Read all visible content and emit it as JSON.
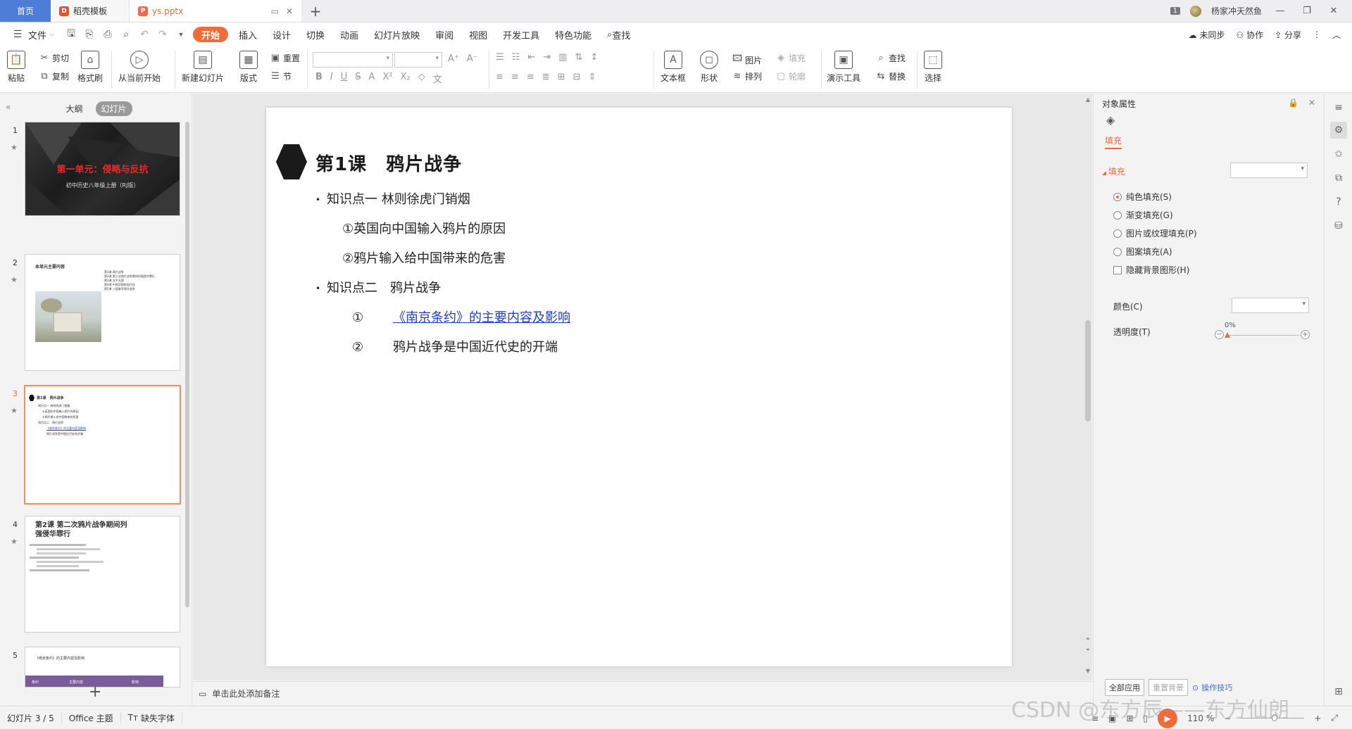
{
  "titlebar": {
    "tabs": [
      {
        "label": "首页"
      },
      {
        "label": "稻壳模板"
      },
      {
        "label": "ys.pptx"
      }
    ],
    "notif_count": "1",
    "user_name": "杨家冲天然鱼"
  },
  "menu": {
    "file": "文件",
    "items": [
      "开始",
      "插入",
      "设计",
      "切换",
      "动画",
      "幻灯片放映",
      "审阅",
      "视图",
      "开发工具",
      "特色功能"
    ],
    "search": "查找",
    "right": [
      "未同步",
      "协作",
      "分享"
    ]
  },
  "ribbon": {
    "paste": "粘贴",
    "cut": "剪切",
    "copy": "复制",
    "format_painter": "格式刷",
    "from_current": "从当前开始",
    "new_slide": "新建幻灯片",
    "layout": "版式",
    "reset": "重置",
    "section": "节",
    "textbox": "文本框",
    "shape": "形状",
    "picture": "图片",
    "fill": "填充",
    "arrange": "排列",
    "outline": "轮廓",
    "presenter_tools": "演示工具",
    "find": "查找",
    "replace": "替换",
    "select": "选择"
  },
  "left_panel": {
    "tabs": [
      "大纲",
      "幻灯片"
    ],
    "slides": [
      {
        "num": "1",
        "title": "第一单元：侵略与反抗",
        "subtitle": "初中历史八年级上册（RJ版）"
      },
      {
        "num": "2",
        "title": "本单元主要内容",
        "lines": [
          "第1课 鸦片战争",
          "第2课 第二次鸦片战争期间列强侵华罪行",
          "第3课 太平天国",
          "第4课 中国早期的现代化",
          "第5课 八国联军侵华战争"
        ]
      },
      {
        "num": "3"
      },
      {
        "num": "4",
        "title": "第2课 第二次鸦片战争期间列强侵华罪行"
      },
      {
        "num": "5",
        "title": "《南京条约》的主要内容及影响",
        "headers": [
          "条约",
          "主要内容",
          "影响"
        ]
      }
    ]
  },
  "slide": {
    "title": "第1课　鸦片战争",
    "lines": [
      {
        "bullet": "•",
        "text": "知识点一 林则徐虎门销烟"
      },
      {
        "text": "①英国向中国输入鸦片的原因"
      },
      {
        "text": "②鸦片输入给中国带来的危害"
      },
      {
        "bullet": "•",
        "text": "知识点二　鸦片战争"
      },
      {
        "mark": "①",
        "text": "《南京条约》的主要内容及影响"
      },
      {
        "mark": "②",
        "text": "鸦片战争是中国近代史的开端"
      }
    ]
  },
  "notes_placeholder": "单击此处添加备注",
  "props": {
    "title": "对象属性",
    "tab": "填充",
    "section": "填充",
    "options": [
      "纯色填充(S)",
      "渐变填充(G)",
      "图片或纹理填充(P)",
      "图案填充(A)"
    ],
    "hide_bg": "隐藏背景图形(H)",
    "color_label": "颜色(C)",
    "transparency_label": "透明度(T)",
    "transparency": "0%",
    "apply_all": "全部应用",
    "reset_bg": "重置背景",
    "tips": "操作技巧"
  },
  "status": {
    "slide_info": "幻灯片 3 / 5",
    "theme": "Office 主题",
    "missing_font": "缺失字体",
    "zoom": "110 %"
  },
  "watermark": "CSDN @东方辰——东方仙朗",
  "colors": {
    "accent": "#f06b3a",
    "link": "#1f3dd8",
    "home_tab": "#4d7dd6"
  }
}
